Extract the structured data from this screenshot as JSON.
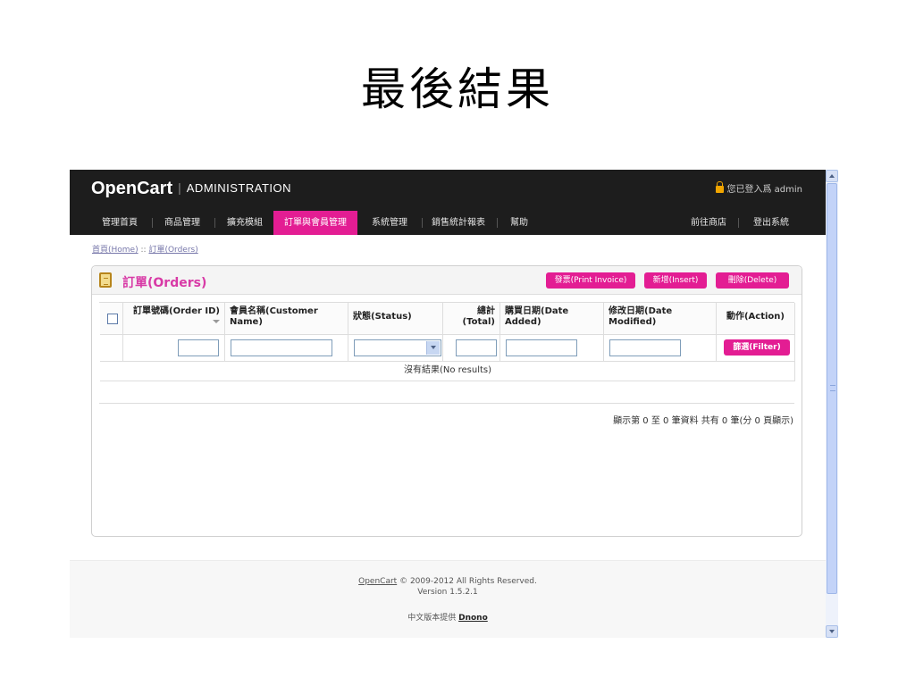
{
  "slide_title": "最後結果",
  "header": {
    "logo_brand": "OpenCart",
    "logo_separator": "|",
    "logo_admin": "ADMINISTRATION",
    "login_text": "您已登入爲 admin"
  },
  "menu": {
    "items": [
      {
        "label": "管理首頁"
      },
      {
        "label": "商品管理"
      },
      {
        "label": "擴充模組"
      },
      {
        "label": "訂單與會員管理",
        "active": true
      },
      {
        "label": "系統管理"
      },
      {
        "label": "銷售統計報表"
      },
      {
        "label": "幫助"
      }
    ],
    "right_items": [
      {
        "label": "前往商店"
      },
      {
        "label": "登出系統"
      }
    ]
  },
  "breadcrumb": {
    "home": "首頁(Home)",
    "separator": "::",
    "current": "訂單(Orders)"
  },
  "box": {
    "title": "訂單(Orders)",
    "buttons": {
      "print_invoice": "發票(Print Invoice)",
      "insert": "新增(Insert)",
      "delete": "刪除(Delete)"
    }
  },
  "table": {
    "columns": {
      "order_id": "訂單號碼(Order ID)",
      "customer": "會員名稱(Customer Name)",
      "status": "狀態(Status)",
      "total": "總計 (Total)",
      "date_added": "購買日期(Date Added)",
      "date_modified": "修改日期(Date Modified)",
      "action": "動作(Action)"
    },
    "filter_button": "篩選(Filter)",
    "filter_values": {
      "order_id": "",
      "customer": "",
      "status": "",
      "total": "",
      "date_added": "",
      "date_modified": ""
    },
    "no_results": "沒有結果(No results)"
  },
  "pagination": "顯示第 0 至 0 筆資料 共有 0 筆(分 0 頁顯示)",
  "footer": {
    "brand_link": "OpenCart",
    "copyright": "© 2009-2012 All Rights Reserved.",
    "version": "Version 1.5.2.1",
    "translation_prefix": "中文版本提供",
    "translator": "Dnono"
  }
}
